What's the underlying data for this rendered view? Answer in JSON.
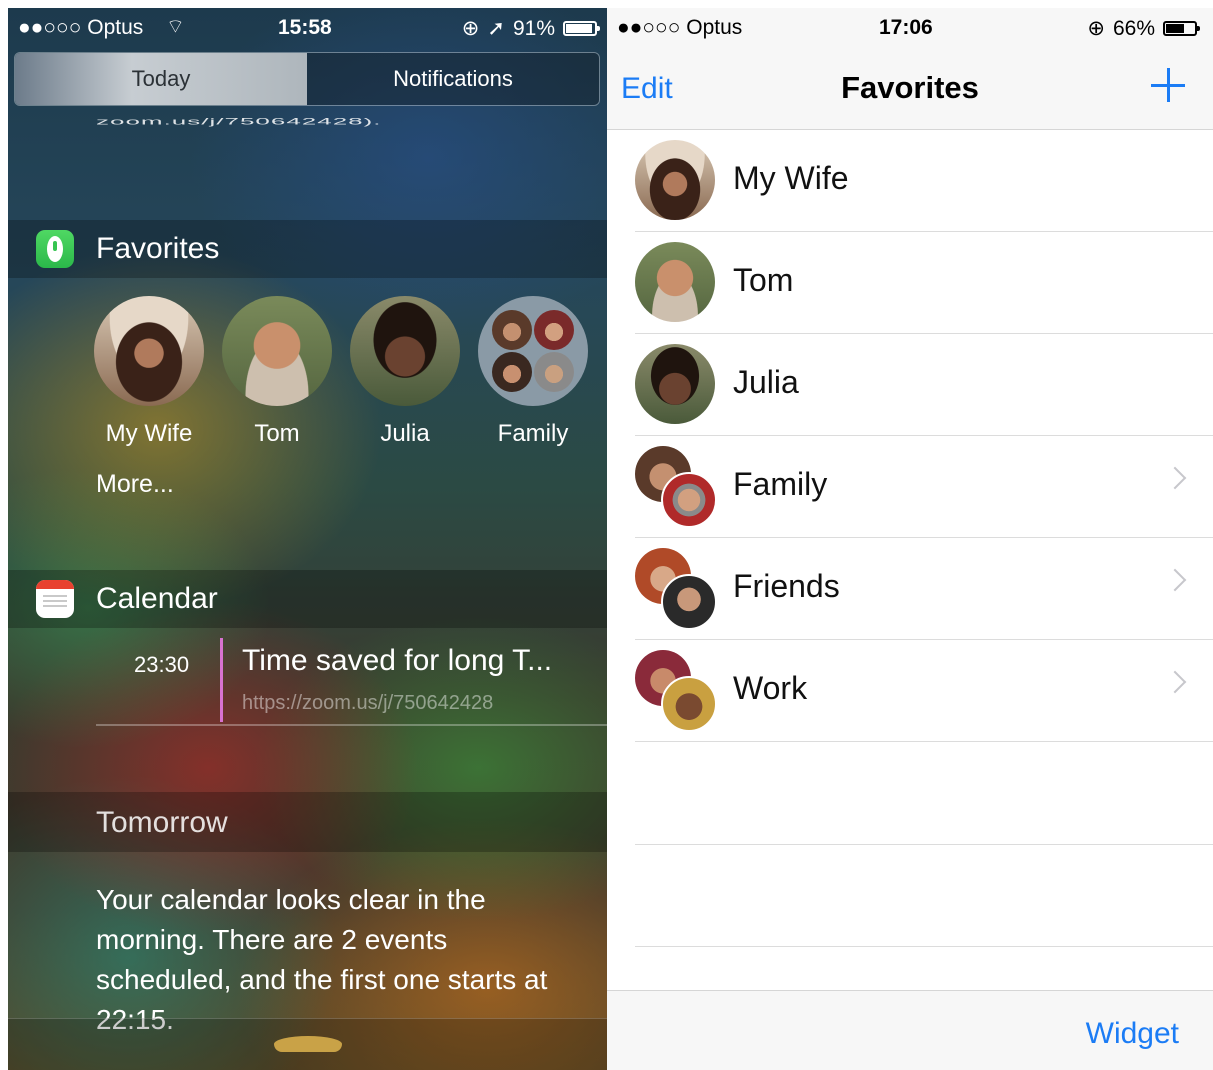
{
  "left": {
    "status": {
      "carrier": "●●○○○ Optus",
      "time": "15:58",
      "battery": "91%",
      "battery_level": 0.91
    },
    "segments": {
      "today": "Today",
      "notifications": "Notifications"
    },
    "cut_text": "zoom.us/j/750642428).",
    "favorites": {
      "title": "Favorites",
      "items": [
        {
          "name": "My Wife"
        },
        {
          "name": "Tom"
        },
        {
          "name": "Julia"
        },
        {
          "name": "Family"
        }
      ],
      "more": "More..."
    },
    "calendar": {
      "title": "Calendar",
      "event": {
        "time": "23:30",
        "title": "Time saved for long T...",
        "url": "https://zoom.us/j/750642428"
      }
    },
    "tomorrow": {
      "title": "Tomorrow",
      "text": "Your calendar looks clear in the morning. There are 2 events scheduled, and the first one starts at 22:15."
    }
  },
  "right": {
    "status": {
      "carrier": "●●○○○ Optus",
      "time": "17:06",
      "battery": "66%",
      "battery_level": 0.66
    },
    "nav": {
      "edit": "Edit",
      "title": "Favorites"
    },
    "rows": [
      {
        "name": "My Wife",
        "group": false
      },
      {
        "name": "Tom",
        "group": false
      },
      {
        "name": "Julia",
        "group": false
      },
      {
        "name": "Family",
        "group": true
      },
      {
        "name": "Friends",
        "group": true
      },
      {
        "name": "Work",
        "group": true
      }
    ],
    "toolbar": {
      "widget": "Widget"
    }
  },
  "colors": {
    "accent": "#1b7cf5",
    "event_bar": "#d872d0",
    "favorites_icon": "#36c451",
    "calendar_icon": "#e8412f"
  }
}
